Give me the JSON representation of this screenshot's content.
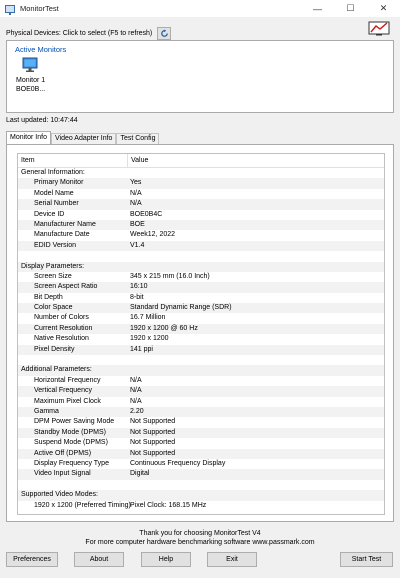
{
  "window": {
    "title": "MonitorTest",
    "minimize_glyph": "—",
    "maximize_glyph": "☐",
    "close_glyph": "✕"
  },
  "physical_devices": {
    "label": "Physical Devices: Click to select (F5 to refresh)",
    "refresh_icon": "refresh-icon"
  },
  "active_monitors": {
    "title": "Active Monitors",
    "items": [
      {
        "line1": "Monitor 1",
        "line2": "BOE0B..."
      }
    ]
  },
  "last_updated": "Last updated:  10:47:44",
  "tabs": [
    {
      "label": "Monitor Info",
      "active": true
    },
    {
      "label": "Video Adapter Info",
      "active": false
    },
    {
      "label": "Test Config",
      "active": false
    }
  ],
  "table": {
    "headers": {
      "item": "Item",
      "value": "Value"
    },
    "rows": [
      {
        "item": "General Information:",
        "value": "",
        "indent": false
      },
      {
        "item": "Primary Monitor",
        "value": "Yes",
        "indent": true
      },
      {
        "item": "Model Name",
        "value": "N/A",
        "indent": true
      },
      {
        "item": "Serial Number",
        "value": "N/A",
        "indent": true
      },
      {
        "item": "Device ID",
        "value": "BOE0B4C",
        "indent": true
      },
      {
        "item": "Manufacturer Name",
        "value": "BOE",
        "indent": true
      },
      {
        "item": "Manufacture Date",
        "value": "Week12, 2022",
        "indent": true
      },
      {
        "item": "EDID Version",
        "value": "V1.4",
        "indent": true
      },
      {
        "item": "",
        "value": "",
        "indent": false
      },
      {
        "item": "Display Parameters:",
        "value": "",
        "indent": false
      },
      {
        "item": "Screen Size",
        "value": "345 x 215 mm (16.0 Inch)",
        "indent": true
      },
      {
        "item": "Screen Aspect Ratio",
        "value": "16:10",
        "indent": true
      },
      {
        "item": "Bit Depth",
        "value": "8-bit",
        "indent": true
      },
      {
        "item": "Color Space",
        "value": "Standard Dynamic Range (SDR)",
        "indent": true
      },
      {
        "item": "Number of Colors",
        "value": "16.7 Million",
        "indent": true
      },
      {
        "item": "Current Resolution",
        "value": "1920 x 1200 @ 60 Hz",
        "indent": true
      },
      {
        "item": "Native Resolution",
        "value": "1920 x 1200",
        "indent": true
      },
      {
        "item": "Pixel Density",
        "value": "141 ppi",
        "indent": true
      },
      {
        "item": "",
        "value": "",
        "indent": false
      },
      {
        "item": "Additional Parameters:",
        "value": "",
        "indent": false
      },
      {
        "item": "Horizontal Frequency",
        "value": "N/A",
        "indent": true
      },
      {
        "item": "Vertical Frequency",
        "value": "N/A",
        "indent": true
      },
      {
        "item": "Maximum Pixel Clock",
        "value": "N/A",
        "indent": true
      },
      {
        "item": "Gamma",
        "value": "2.20",
        "indent": true
      },
      {
        "item": "DPM Power Saving Mode",
        "value": "Not Supported",
        "indent": true
      },
      {
        "item": "Standby Mode (DPMS)",
        "value": "Not Supported",
        "indent": true
      },
      {
        "item": "Suspend Mode (DPMS)",
        "value": "Not Supported",
        "indent": true
      },
      {
        "item": "Active Off (DPMS)",
        "value": "Not Supported",
        "indent": true
      },
      {
        "item": "Display Frequency Type",
        "value": "Continuous Frequency Display",
        "indent": true
      },
      {
        "item": "Video Input Signal",
        "value": "Digital",
        "indent": true
      },
      {
        "item": "",
        "value": "",
        "indent": false
      },
      {
        "item": "Supported Video Modes:",
        "value": "",
        "indent": false
      },
      {
        "item": "1920 x 1200 (Preferred Timing)",
        "value": "Pixel Clock: 168.15 MHz",
        "indent": true
      }
    ]
  },
  "footer": {
    "line1": "Thank you for choosing MonitorTest V4",
    "line2": "For more computer hardware benchmarking software www.passmark.com"
  },
  "buttons": {
    "preferences": "Preferences",
    "about": "About",
    "help": "Help",
    "exit": "Exit",
    "start_test": "Start Test"
  },
  "colors": {
    "accent": "#0050b4",
    "row_alt": "#f2f2f2",
    "border": "#aaaaaa"
  }
}
